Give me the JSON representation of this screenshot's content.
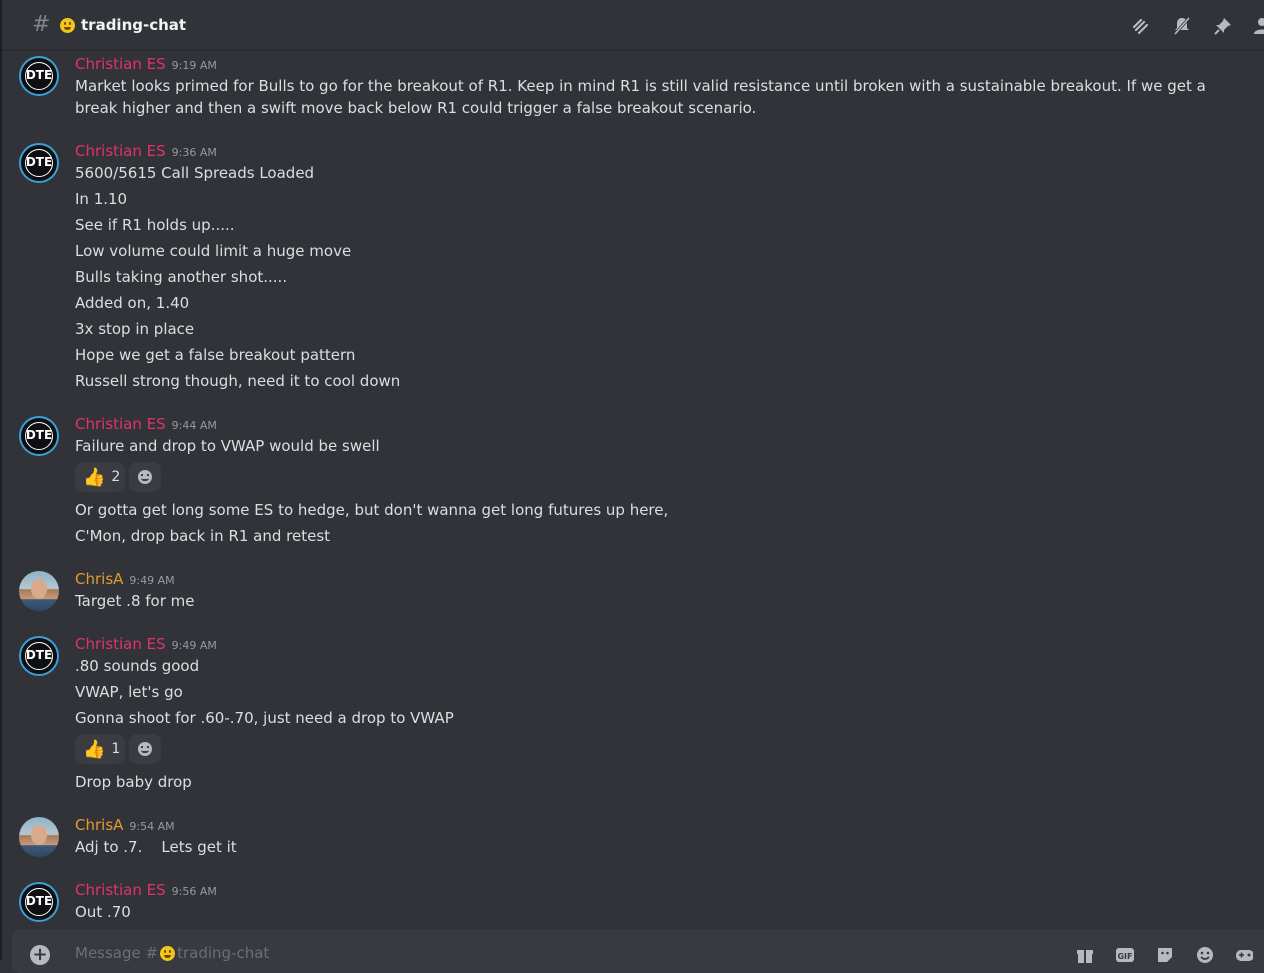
{
  "header": {
    "channel_name": "trading-chat",
    "icons": [
      "threads-icon",
      "mute-notifications-icon",
      "pin-icon",
      "member-list-icon"
    ]
  },
  "messages": [
    {
      "author": "Christian ES",
      "time": "9:19 AM",
      "avatar_text": "DTE",
      "lines": [
        "Market looks primed for Bulls to go for the breakout of R1. Keep in mind R1 is still valid resistance until broken with a sustainable breakout. If we get a break higher and then a swift move back below R1 could trigger a false breakout scenario."
      ]
    },
    {
      "author": "Christian ES",
      "time": "9:36 AM",
      "avatar_text": "DTE",
      "lines": [
        "5600/5615 Call Spreads Loaded",
        "In 1.10",
        "See if R1 holds up.....",
        "Low volume could limit a huge move",
        "Bulls taking another shot.....",
        "Added on, 1.40",
        "3x stop in place",
        "Hope we get a false breakout pattern",
        "Russell strong though, need it to cool down"
      ]
    },
    {
      "author": "Christian ES",
      "time": "9:44 AM",
      "avatar_text": "DTE",
      "lines": [
        "Failure and drop to VWAP would be swell"
      ],
      "reaction_count": "2",
      "lines_after": [
        "Or gotta get long some ES to hedge, but don't wanna get long futures up here,",
        "C'Mon, drop back in R1 and retest"
      ]
    },
    {
      "author": "ChrisA",
      "time": "9:49 AM",
      "lines": [
        "Target .8 for me"
      ]
    },
    {
      "author": "Christian ES",
      "time": "9:49 AM",
      "avatar_text": "DTE",
      "lines": [
        ".80 sounds good",
        "VWAP, let's go",
        "Gonna shoot for .60-.70, just need a drop to VWAP"
      ],
      "reaction_count": "1",
      "lines_after": [
        "Drop baby drop"
      ]
    },
    {
      "author": "ChrisA",
      "time": "9:54 AM",
      "lines": [
        "Adj to .7.    Lets get it"
      ]
    },
    {
      "author": "Christian ES",
      "time": "9:56 AM",
      "avatar_text": "DTE",
      "lines": [
        "Out .70"
      ]
    }
  ],
  "composer": {
    "placeholder_prefix": "Message #",
    "placeholder_channel": "trading-chat",
    "icons": [
      "add-attachment-icon",
      "gift-icon",
      "gif-icon",
      "sticker-icon",
      "emoji-icon",
      "apps-icon"
    ]
  },
  "colors": {
    "background": "#313338",
    "author_christian": "#e0336b",
    "author_chrisa": "#e39a2c",
    "text": "#dbdee1",
    "muted": "#949ba4"
  }
}
